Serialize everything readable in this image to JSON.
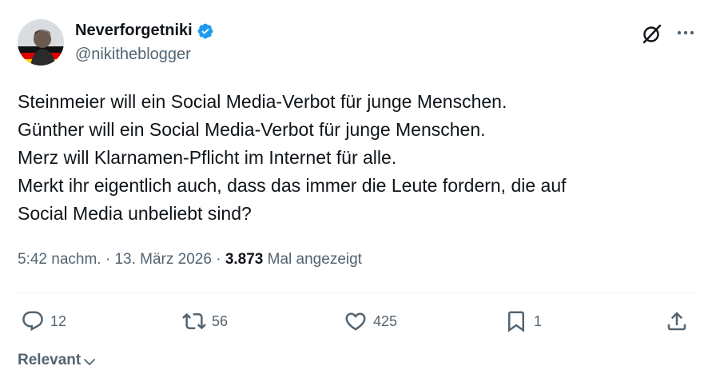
{
  "author": {
    "display_name": "Neverforgetniki",
    "handle": "@nikitheblogger",
    "verified_icon": "verified-badge-icon",
    "verified_color": "#1d9bf0"
  },
  "header_icons": {
    "grok": "grok-icon",
    "more": "more-options-icon"
  },
  "tweet": {
    "lines": [
      "Steinmeier will ein Social Media-Verbot für junge Menschen.",
      "Günther will ein Social Media-Verbot für junge Menschen.",
      "Merz will Klarnamen-Pflicht im Internet für alle.",
      "Merkt ihr eigentlich auch, dass das immer die Leute fordern, die auf",
      "Social Media unbeliebt sind?"
    ]
  },
  "meta": {
    "time": "5:42 nachm.",
    "separator": " · ",
    "date": "13. März 2026",
    "views": "3.873",
    "views_label": "Mal angezeigt"
  },
  "actions": {
    "replies": {
      "icon": "reply-icon",
      "count": "12"
    },
    "reposts": {
      "icon": "repost-icon",
      "count": "56"
    },
    "likes": {
      "icon": "like-icon",
      "count": "425"
    },
    "bookmarks": {
      "icon": "bookmark-icon",
      "count": "1"
    },
    "share": {
      "icon": "share-icon"
    }
  },
  "replies_sort": {
    "label": "Relevant",
    "icon": "chevron-down-icon"
  }
}
